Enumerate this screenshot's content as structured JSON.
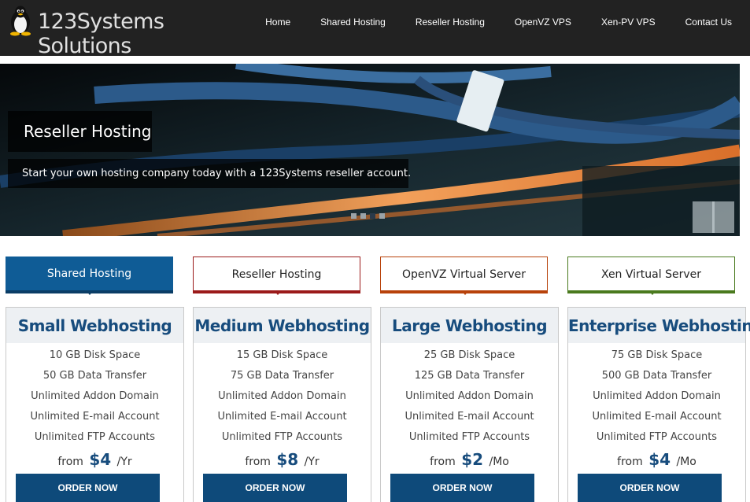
{
  "site": {
    "logo_text": "123Systems Solutions"
  },
  "nav": {
    "items": [
      {
        "label": "Home"
      },
      {
        "label": "Shared Hosting"
      },
      {
        "label": "Reseller Hosting"
      },
      {
        "label": "OpenVZ VPS"
      },
      {
        "label": "Xen-PV VPS"
      },
      {
        "label": "Contact Us"
      }
    ]
  },
  "hero": {
    "title": "Reseller Hosting",
    "subtitle": "Start your own hosting company today with a 123Systems reseller account.",
    "slides": 4,
    "active_slide": 3
  },
  "tabs": [
    {
      "label": "Shared Hosting",
      "style": "filled",
      "color": "#0f5c96"
    },
    {
      "label": "Reseller Hosting",
      "style": "outline",
      "color": "#9b1a1a"
    },
    {
      "label": "OpenVZ Virtual Server",
      "style": "outline",
      "color": "#b8420a"
    },
    {
      "label": "Xen Virtual Server",
      "style": "outline",
      "color": "#4a7a1e"
    }
  ],
  "plans": [
    {
      "name": "Small Webhosting",
      "features": [
        "10 GB Disk Space",
        "50 GB Data Transfer",
        "Unlimited Addon Domain",
        "Unlimited E-mail Account",
        "Unlimited FTP Accounts"
      ],
      "price_prefix": "from",
      "price": "$4",
      "period": "/Yr",
      "button": "ORDER NOW"
    },
    {
      "name": "Medium Webhosting",
      "features": [
        "15 GB Disk Space",
        "75 GB Data Transfer",
        "Unlimited Addon Domain",
        "Unlimited E-mail Account",
        "Unlimited FTP Accounts"
      ],
      "price_prefix": "from",
      "price": "$8",
      "period": "/Yr",
      "button": "ORDER NOW"
    },
    {
      "name": "Large Webhosting",
      "features": [
        "25 GB Disk Space",
        "125 GB Data Transfer",
        "Unlimited Addon Domain",
        "Unlimited E-mail Account",
        "Unlimited FTP Accounts"
      ],
      "price_prefix": "from",
      "price": "$2",
      "period": "/Mo",
      "button": "ORDER NOW"
    },
    {
      "name": "Enterprise Webhosting",
      "features": [
        "75 GB Disk Space",
        "500 GB Data Transfer",
        "Unlimited Addon Domain",
        "Unlimited E-mail Account",
        "Unlimited FTP Accounts"
      ],
      "price_prefix": "from",
      "price": "$4",
      "period": "/Mo",
      "button": "ORDER NOW"
    }
  ],
  "colors": {
    "header_bg": "#222222",
    "accent_blue": "#0e4a7a",
    "plan_title": "#174c7d"
  }
}
